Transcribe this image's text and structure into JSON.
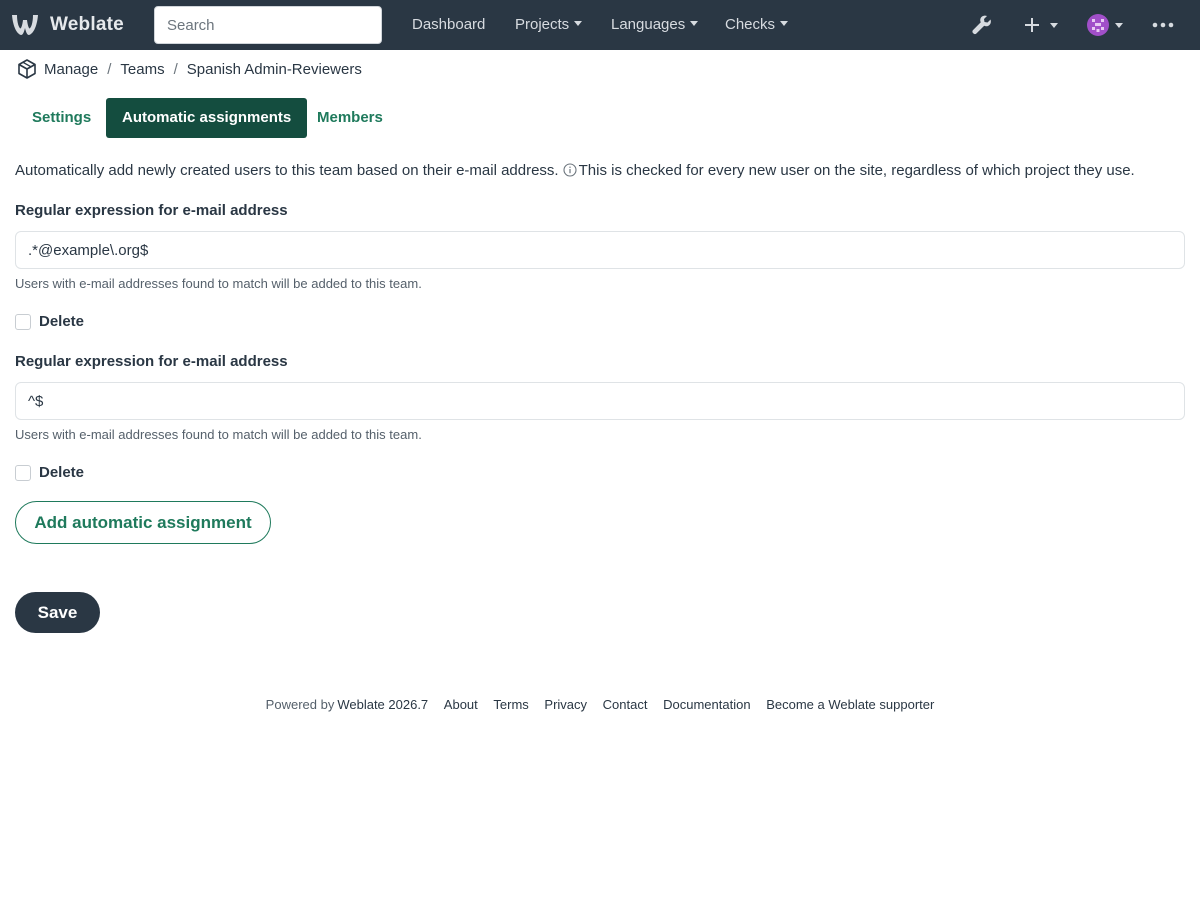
{
  "app": {
    "brand": "Weblate"
  },
  "navbar": {
    "search_placeholder": "Search",
    "items": [
      {
        "label": "Dashboard"
      },
      {
        "label": "Projects"
      },
      {
        "label": "Languages"
      },
      {
        "label": "Checks"
      }
    ],
    "icons": [
      "wrench-icon",
      "plus-icon",
      "avatar",
      "more-icon"
    ],
    "background": "#2a3744"
  },
  "breadcrumb": {
    "items": [
      "Manage",
      "Teams",
      "Spanish Admin-Reviewers"
    ],
    "separator": "/"
  },
  "tabs": [
    {
      "label": "Settings",
      "active": false
    },
    {
      "label": "Automatic assignments",
      "active": true
    },
    {
      "label": "Members",
      "active": false
    }
  ],
  "main": {
    "intro_text": "Automatically add newly created users to this team based on their e-mail address.",
    "intro_note": "This is checked for every new user on the site, regardless of which project they use.",
    "assignments": [
      {
        "label": "Regular expression for e-mail address",
        "value": ".*@example\\.org$",
        "help": "Users with e-mail addresses found to match will be added to this team.",
        "delete_label": "Delete",
        "delete_checked": false
      },
      {
        "label": "Regular expression for e-mail address",
        "value": "^$",
        "help": "Users with e-mail addresses found to match will be added to this team.",
        "delete_label": "Delete",
        "delete_checked": false
      }
    ],
    "add_button": "Add automatic assignment",
    "save_button": "Save"
  },
  "footer": {
    "powered_by": "Powered by",
    "version": "Weblate 2026.7",
    "links": [
      "About",
      "Terms",
      "Privacy",
      "Contact",
      "Documentation",
      "Become a Weblate supporter"
    ]
  },
  "colors": {
    "accent": "#1f7a5c",
    "active_tab": "#144d3f",
    "dark": "#2a3744"
  }
}
